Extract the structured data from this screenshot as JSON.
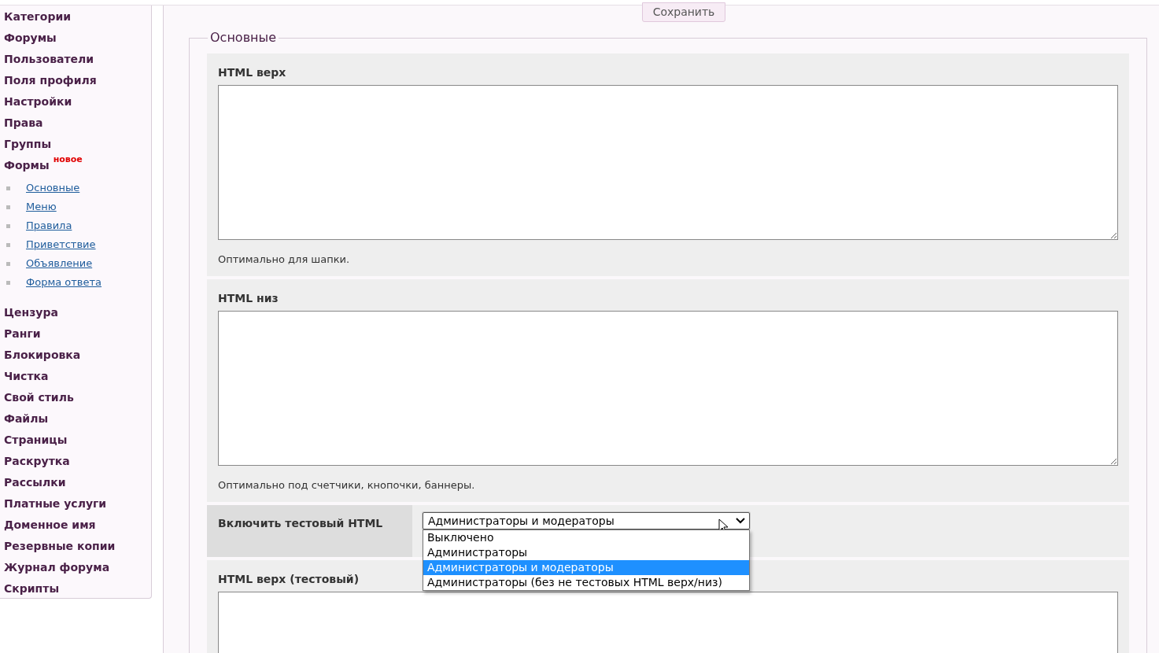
{
  "sidebar": {
    "items": [
      {
        "label": "Категории"
      },
      {
        "label": "Форумы"
      },
      {
        "label": "Пользователи"
      },
      {
        "label": "Поля профиля"
      },
      {
        "label": "Настройки"
      },
      {
        "label": "Права"
      },
      {
        "label": "Группы"
      },
      {
        "label": "Формы",
        "badge": "новое",
        "children": [
          {
            "label": "Основные"
          },
          {
            "label": "Меню"
          },
          {
            "label": "Правила"
          },
          {
            "label": "Приветствие"
          },
          {
            "label": "Объявление"
          },
          {
            "label": "Форма ответа"
          }
        ]
      },
      {
        "label": "Цензура"
      },
      {
        "label": "Ранги"
      },
      {
        "label": "Блокировка"
      },
      {
        "label": "Чистка"
      },
      {
        "label": "Свой стиль"
      },
      {
        "label": "Файлы"
      },
      {
        "label": "Страницы"
      },
      {
        "label": "Раскрутка"
      },
      {
        "label": "Рассылки"
      },
      {
        "label": "Платные услуги"
      },
      {
        "label": "Доменное имя"
      },
      {
        "label": "Резервные копии"
      },
      {
        "label": "Журнал форума"
      },
      {
        "label": "Скрипты"
      }
    ]
  },
  "save_button": "Сохранить",
  "fieldset": {
    "legend": "Основные",
    "fields": [
      {
        "kind": "textarea",
        "label": "HTML верх",
        "hint": "Оптимально для шапки."
      },
      {
        "kind": "textarea",
        "label": "HTML низ",
        "hint": "Оптимально под счетчики, кнопочки, баннеры."
      },
      {
        "kind": "select",
        "label": "Включить тестовый HTML",
        "value": "Администраторы и модераторы",
        "expanded": true,
        "options": [
          {
            "label": "Выключено",
            "selected": false
          },
          {
            "label": "Администраторы",
            "selected": false
          },
          {
            "label": "Администраторы и модераторы",
            "selected": true
          },
          {
            "label": "Администраторы (без не тестовых HTML верх/низ)",
            "selected": false
          }
        ]
      },
      {
        "kind": "textarea",
        "label": "HTML верх (тестовый)"
      }
    ]
  }
}
